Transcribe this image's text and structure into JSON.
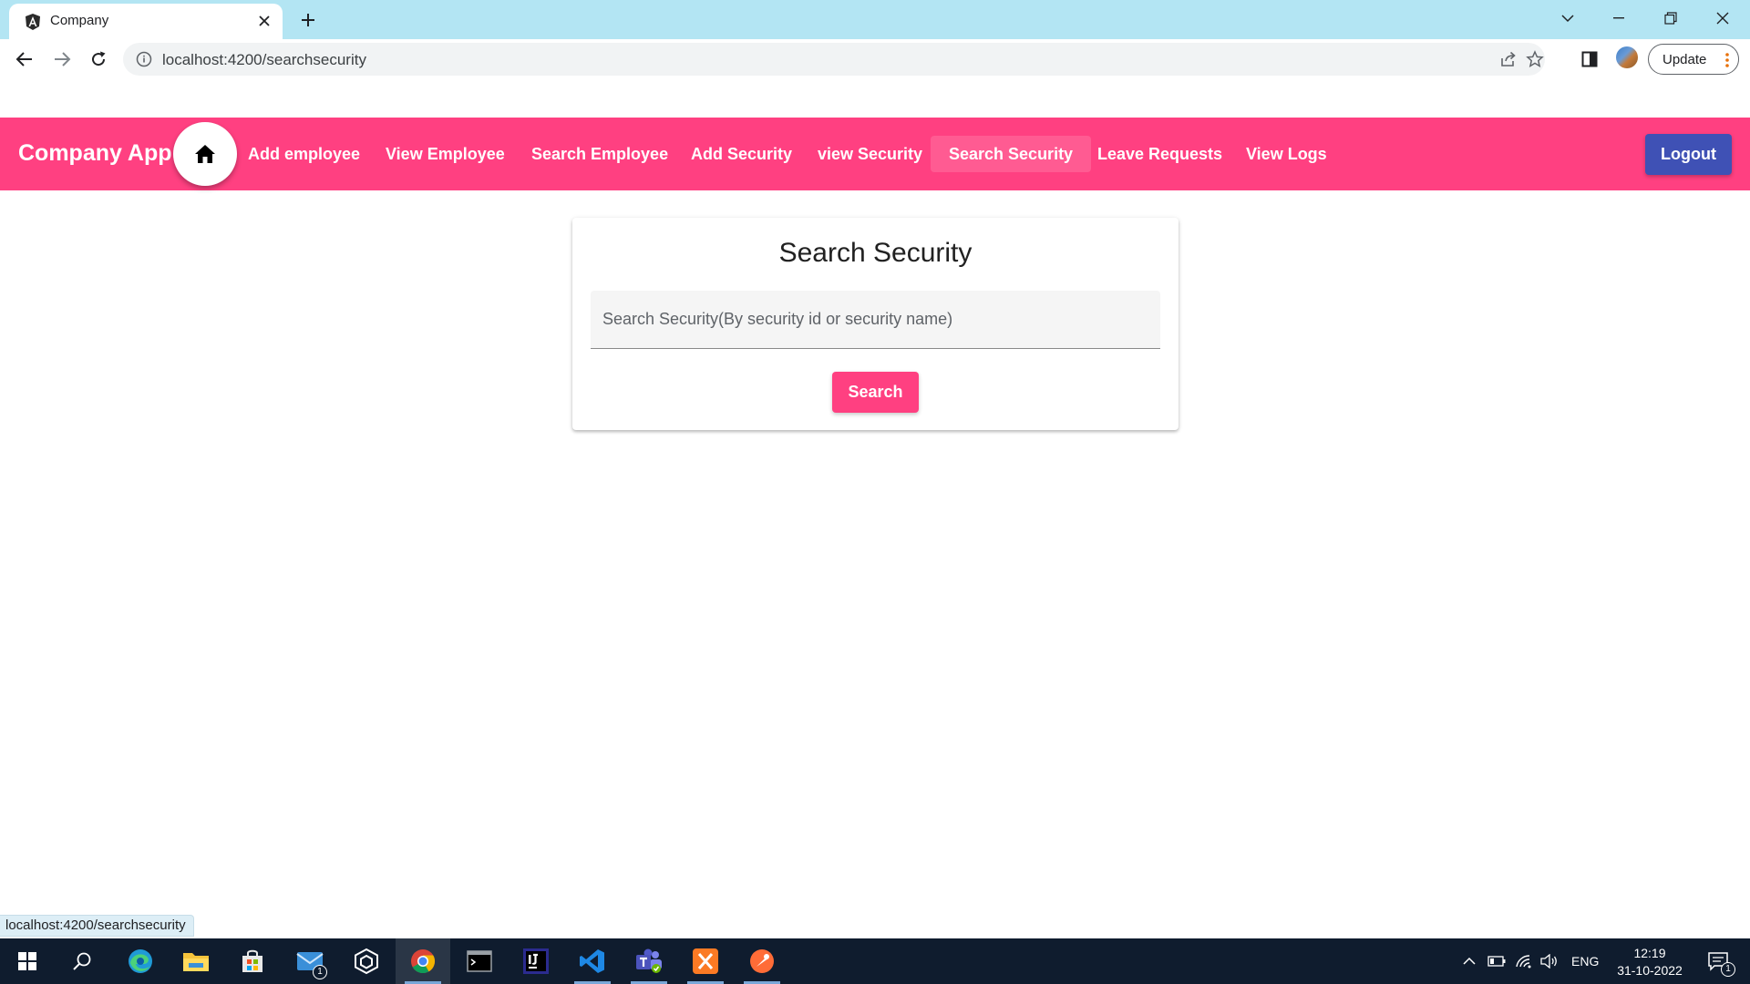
{
  "browser": {
    "tab_title": "Company",
    "url": "localhost:4200/searchsecurity",
    "update_label": "Update"
  },
  "navbar": {
    "brand": "Company App .",
    "links": [
      {
        "label": "Add employee"
      },
      {
        "label": "View Employee"
      },
      {
        "label": "Search Employee"
      },
      {
        "label": "Add Security"
      },
      {
        "label": "view Security"
      },
      {
        "label": "Search Security",
        "active": true
      },
      {
        "label": "Leave Requests"
      },
      {
        "label": "View Logs"
      }
    ],
    "logout_label": "Logout"
  },
  "card": {
    "title": "Search Security",
    "search_placeholder": "Search Security(By security id or security name)",
    "search_value": "",
    "search_button": "Search"
  },
  "status_bar": {
    "hover_url": "localhost:4200/searchsecurity"
  },
  "taskbar": {
    "mail_badge": "1",
    "language": "ENG",
    "time": "12:19",
    "date": "31-10-2022",
    "notification_badge": "1"
  },
  "colors": {
    "navbar": "#ff4081",
    "primary_button": "#ff4081",
    "logout_button": "#3f51b5",
    "tabstrip": "#b3e5f3",
    "taskbar": "#0f1c2e"
  }
}
